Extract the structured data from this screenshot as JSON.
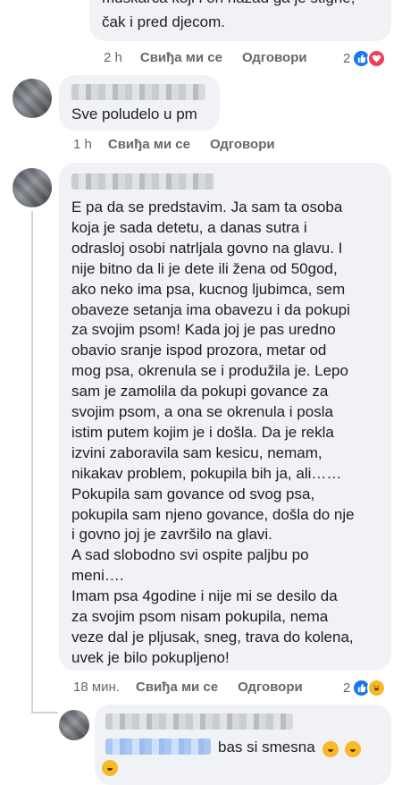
{
  "comment1": {
    "text_lines": [
      "muškarca koji i on nazad ga je stigne,",
      "čak i pred djecom."
    ],
    "time": "2 h",
    "like_label": "Свиђа ми се",
    "reply_label": "Одговори",
    "reaction_count": "2"
  },
  "comment2": {
    "text": "Sve poludelo u pm",
    "time": "1 h",
    "like_label": "Свиђа ми се",
    "reply_label": "Одговори"
  },
  "comment3": {
    "lines": [
      "E pa da se predstavim. Ja sam ta osoba",
      "koja je sada detetu, a danas sutra i",
      "odrasloj osobi natrljala govno na glavu. I",
      "nije bitno da li je dete ili žena od 50god,",
      "ako neko ima psa, kucnog ljubimca, sem",
      "obaveze setanja ima obavezu i da pokupi",
      "za svojim psom! Kada joj je pas uredno",
      "obavio sranje ispod prozora, metar od",
      "mog psa, okrenula se i produžila je. Lepo",
      "sam je zamolila da pokupi govance za",
      "svojim psom, a ona se okrenula i posla",
      "istim putem kojim je i došla. Da je rekla",
      "izvini zaboravila sam kesicu, nemam,",
      "nikakav problem, pokupila bih ja, ali……",
      "Pokupila sam govance od svog psa,",
      "pokupila sam njeno govance, došla do nje",
      "i govno joj je završilo na glavi.",
      "A sad slobodno svi ospite paljbu po",
      "meni….",
      "Imam psa 4godine i nije mi se desilo da",
      "za svojim psom nisam pokupila, nema",
      "veze dal je pljusak, sneg, trava do kolena,",
      "uvek je bilo pokupljeno!"
    ],
    "time": "18 мин.",
    "like_label": "Свиђа ми се",
    "reply_label": "Одговори",
    "reaction_count": "2"
  },
  "reply1": {
    "text": "bas si smesna"
  },
  "colors": {
    "bubble": "#f0f2f5",
    "meta_text": "#65676b",
    "like_blue": "#1877f2",
    "love_red": "#f33e58",
    "haha_yellow": "#f7b928"
  }
}
